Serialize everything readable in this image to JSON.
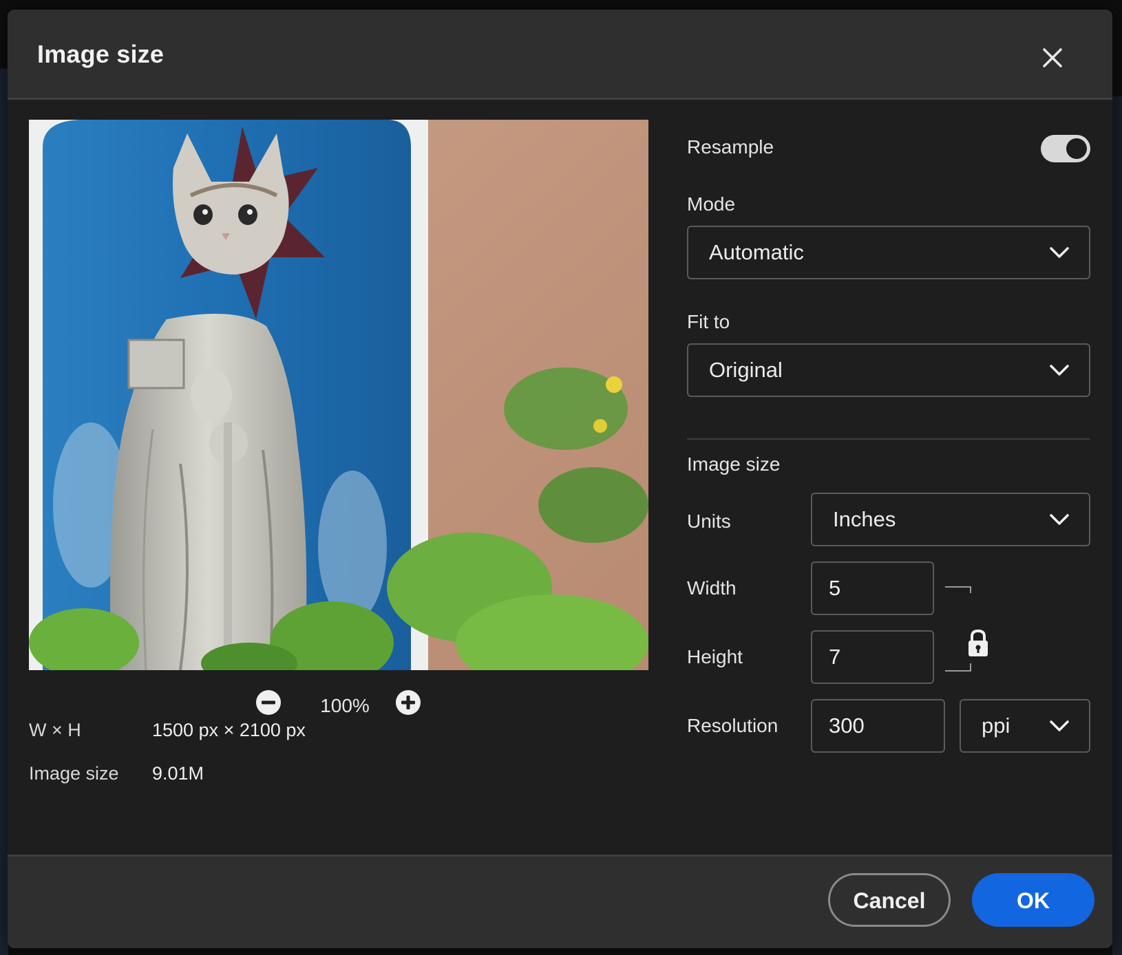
{
  "dialog": {
    "title": "Image size",
    "close_icon": "close-icon"
  },
  "preview": {
    "zoom_level": "100%",
    "zoom_out_icon": "minus-circle-icon",
    "zoom_in_icon": "plus-circle-icon"
  },
  "info": {
    "dimensions_label": "W × H",
    "dimensions_value": "1500 px × 2100 px",
    "size_label": "Image size",
    "size_value": "9.01M"
  },
  "settings": {
    "resample_label": "Resample",
    "resample_on": true,
    "mode_label": "Mode",
    "mode_value": "Automatic",
    "fit_label": "Fit to",
    "fit_value": "Original",
    "section_title": "Image size",
    "units_label": "Units",
    "units_value": "Inches",
    "width_label": "Width",
    "width_value": "5",
    "height_label": "Height",
    "height_value": "7",
    "resolution_label": "Resolution",
    "resolution_value": "300",
    "resolution_unit": "ppi",
    "lock_icon": "lock-icon",
    "chevron_icon": "chevron-down-icon"
  },
  "footer": {
    "cancel_label": "Cancel",
    "ok_label": "OK"
  },
  "colors": {
    "accent": "#1266e0",
    "dialog_bg": "#1e1e1e",
    "header_bg": "#2f2f2f",
    "border": "#5a5a5a"
  }
}
